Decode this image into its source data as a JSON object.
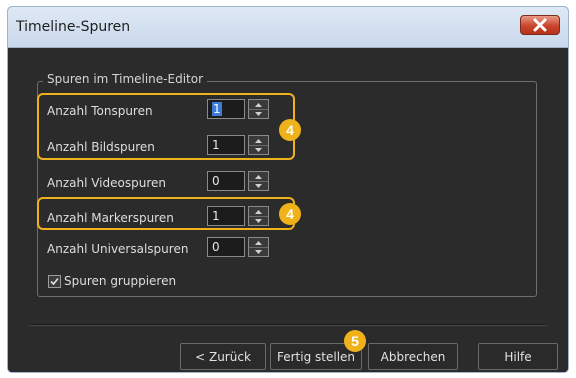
{
  "window": {
    "title": "Timeline-Spuren"
  },
  "group": {
    "title": "Spuren im Timeline-Editor",
    "rows": [
      {
        "label": "Anzahl Tonspuren",
        "value": "1"
      },
      {
        "label": "Anzahl Bildspuren",
        "value": "1"
      },
      {
        "label": "Anzahl Videospuren",
        "value": "0"
      },
      {
        "label": "Anzahl Markerspuren",
        "value": "1"
      },
      {
        "label": "Anzahl Universalspuren",
        "value": "0"
      }
    ],
    "checkbox": {
      "label": "Spuren gruppieren",
      "checked": true
    }
  },
  "badges": {
    "b1": "4",
    "b2": "4",
    "b3": "5"
  },
  "buttons": {
    "back": "< Zurück",
    "finish": "Fertig stellen",
    "cancel": "Abbrechen",
    "help": "Hilfe"
  },
  "colors": {
    "highlight": "#f0b21b",
    "close": "#c9452c",
    "background": "#2b2b2b"
  },
  "icons": {
    "close": "close-icon",
    "spin_up": "arrow-up-icon",
    "spin_down": "arrow-down-icon",
    "check": "checkmark-icon"
  }
}
